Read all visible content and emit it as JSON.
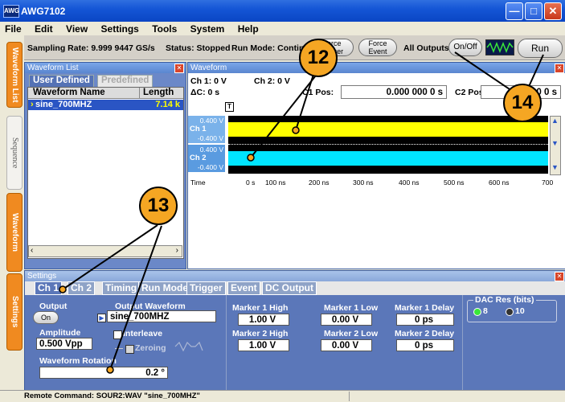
{
  "window": {
    "logo": "AWG",
    "title": "AWG7102"
  },
  "menu": [
    "File",
    "Edit",
    "View",
    "Settings",
    "Tools",
    "System",
    "Help"
  ],
  "toolbar": {
    "sampling": "Sampling Rate: 9.999 9447 GS/s",
    "status": "Status: Stopped",
    "runmode": "Run Mode: Continuo",
    "force_trigger": "Force\nTrigger",
    "force_event": "Force\nEvent",
    "all_outputs": "All Outputs",
    "onoff": "On/Off",
    "run": "Run"
  },
  "left_tabs": [
    "Waveform List",
    "Sequence",
    "Waveform",
    "Settings"
  ],
  "waveform_list": {
    "title": "Waveform List",
    "tabs": [
      "User Defined",
      "Predefined"
    ],
    "headers": [
      "Waveform Name",
      "Length"
    ],
    "rows": [
      {
        "name": "sine_700MHZ",
        "length": "7.14 k"
      }
    ]
  },
  "waveform": {
    "title": "Waveform",
    "ch1": "Ch 1: 0 V",
    "ch2": "Ch 2: 0 V",
    "delta": "ΔC: 0 s",
    "c1_label": "C1 Pos:",
    "c1_value": "0.000 000 0 s",
    "c2_label": "C2 Pos:",
    "c2_value": "0 0 s",
    "marker": "T",
    "channels": [
      {
        "name": "Ch 1",
        "top": "0.400 V",
        "bottom": "-0.400 V",
        "color": "#ffff00"
      },
      {
        "name": "Ch 2",
        "top": "0.400 V",
        "bottom": "-0.400 V",
        "color": "#00e5ff"
      }
    ],
    "time_label": "Time",
    "time_ticks": [
      "0 s",
      "100 ns",
      "200 ns",
      "300 ns",
      "400 ns",
      "500 ns",
      "600 ns",
      "700"
    ]
  },
  "settings": {
    "title": "Settings",
    "tabs": [
      "Ch 1",
      "Ch 2",
      "Timing",
      "Run Mode",
      "Trigger",
      "Event",
      "DC Output"
    ],
    "output_label": "Output",
    "output_button": "On",
    "output_waveform_label": "Output Waveform",
    "output_waveform_value": "sine_700MHZ",
    "amplitude_label": "Amplitude",
    "amplitude_value": "0.500 Vpp",
    "interleave_label": "Interleave",
    "zeroing_label": "Zeroing",
    "rotation_label": "Waveform Rotation",
    "rotation_value": "0.2 °",
    "marker1_high_label": "Marker 1 High",
    "marker1_high": "1.00 V",
    "marker1_low_label": "Marker 1 Low",
    "marker1_low": "0.00 V",
    "marker1_delay_label": "Marker 1 Delay",
    "marker1_delay": "0 ps",
    "marker2_high_label": "Marker 2 High",
    "marker2_high": "1.00 V",
    "marker2_low_label": "Marker 2 Low",
    "marker2_low": "0.00 V",
    "marker2_delay_label": "Marker 2 Delay",
    "marker2_delay": "0 ps",
    "dac_label": "DAC Res (bits)",
    "dac_options": [
      "8",
      "10"
    ]
  },
  "status_bar": "Remote Command: SOUR2:WAV \"sine_700MHZ\"",
  "callouts": [
    "12",
    "13",
    "14"
  ]
}
